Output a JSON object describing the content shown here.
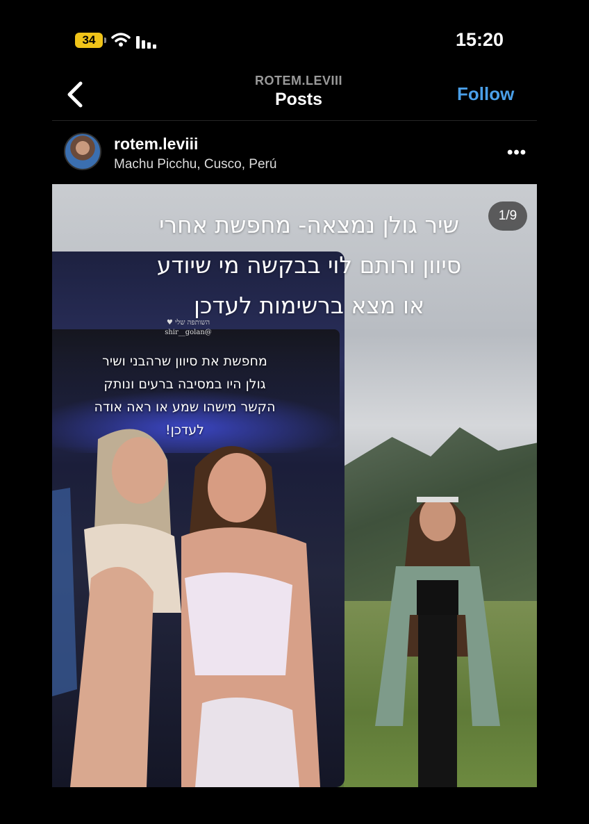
{
  "status_bar": {
    "battery": "34",
    "time": "15:20",
    "icons": [
      "battery-icon",
      "wifi-icon",
      "signal-icon"
    ]
  },
  "nav": {
    "back_icon": "chevron-left-icon",
    "username": "ROTEM.LEVIII",
    "title": "Posts",
    "follow_label": "Follow",
    "follow_color": "#4a9fe8"
  },
  "post": {
    "username": "rotem.leviii",
    "location": "Machu Picchu, Cusco, Perú",
    "more_icon": "more-horizontal-icon",
    "page_indicator": "1/9",
    "caption_lines": [
      "שיר גולן נמצאה- מחפשת אחרי",
      "סיוון ורותם לוי בבקשה מי שיודע",
      "או מצא ברשימות לעדכן"
    ],
    "story": {
      "label": "השותפה שלי",
      "handle": "@shir__golan",
      "text_lines": [
        "מחפשת את סיוון שרהבני ושיר",
        "גולן היו במסיבה ברעים ונותק",
        "הקשר מישהו שמע או ראה אודה",
        "לעדכן!"
      ]
    }
  }
}
